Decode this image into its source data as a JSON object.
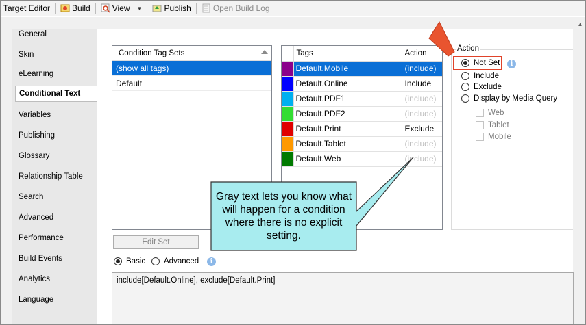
{
  "toolbar": {
    "title": "Target Editor",
    "build": "Build",
    "view": "View",
    "publish": "Publish",
    "open_build_log": "Open Build Log"
  },
  "nav": {
    "items": [
      "General",
      "Skin",
      "eLearning",
      "Conditional Text",
      "Variables",
      "Publishing",
      "Glossary",
      "Relationship Table",
      "Search",
      "Advanced",
      "Performance",
      "Build Events",
      "Analytics",
      "Language"
    ],
    "active": "Conditional Text"
  },
  "tag_sets": {
    "header": "Condition Tag Sets",
    "rows": [
      "(show all tags)",
      "Default"
    ],
    "edit_button": "Edit Set"
  },
  "tags": {
    "col_tags": "Tags",
    "col_action": "Action",
    "rows": [
      {
        "name": "Default.Mobile",
        "action": "(include)",
        "color": "#8b008b",
        "selected": true,
        "gray": false
      },
      {
        "name": "Default.Online",
        "action": "Include",
        "color": "#0000ff",
        "selected": false,
        "gray": false
      },
      {
        "name": "Default.PDF1",
        "action": "(include)",
        "color": "#00b0f0",
        "selected": false,
        "gray": true
      },
      {
        "name": "Default.PDF2",
        "action": "(include)",
        "color": "#33dd33",
        "selected": false,
        "gray": true
      },
      {
        "name": "Default.Print",
        "action": "Exclude",
        "color": "#e00000",
        "selected": false,
        "gray": false
      },
      {
        "name": "Default.Tablet",
        "action": "(include)",
        "color": "#ff9900",
        "selected": false,
        "gray": true
      },
      {
        "name": "Default.Web",
        "action": "(include)",
        "color": "#007a00",
        "selected": false,
        "gray": true
      }
    ]
  },
  "action_group": {
    "title": "Action",
    "not_set": "Not Set",
    "include": "Include",
    "exclude": "Exclude",
    "display_by_media_query": "Display by Media Query",
    "web": "Web",
    "tablet": "Tablet",
    "mobile": "Mobile"
  },
  "mode": {
    "basic": "Basic",
    "advanced": "Advanced"
  },
  "expression": "include[Default.Online], exclude[Default.Print]",
  "callout": {
    "text": "Gray text lets you know what will happen for a condition where there is no explicit setting."
  },
  "colors": {
    "selection": "#0a6fd6",
    "callout_fill": "#a8ecef",
    "highlight": "#e0432a"
  }
}
